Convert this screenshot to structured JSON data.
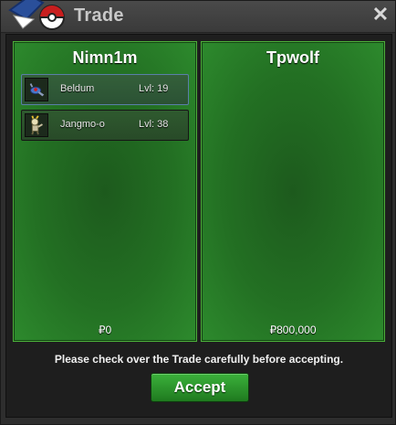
{
  "window": {
    "title": "Trade",
    "close_icon": "close-icon",
    "emblem_icon": "pokeball-emblem-icon"
  },
  "left_panel": {
    "player": "Nimn1m",
    "money": "₽0",
    "pokemon": [
      {
        "name": "Beldum",
        "level": "Lvl: 19",
        "icon": "beldum-icon",
        "selected": true
      },
      {
        "name": "Jangmo-o",
        "level": "Lvl: 38",
        "icon": "jangmo-o-icon",
        "selected": false
      }
    ]
  },
  "right_panel": {
    "player": "Tpwolf",
    "money": "₽800,000",
    "pokemon": []
  },
  "notice": "Please check over the Trade carefully before accepting.",
  "accept_label": "Accept",
  "colors": {
    "panel_green": "#237023",
    "accept_green": "#2e962e",
    "selected_border": "#5a7fa8"
  }
}
